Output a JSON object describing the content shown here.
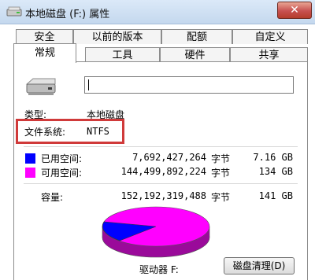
{
  "window": {
    "title": "本地磁盘 (F:) 属性",
    "close_glyph": "✕"
  },
  "tabs": {
    "row1": [
      "安全",
      "以前的版本",
      "配额",
      "自定义"
    ],
    "row2": [
      "常规",
      "工具",
      "硬件",
      "共享"
    ],
    "active": "常规"
  },
  "general": {
    "name_value": "",
    "type_label": "类型:",
    "type_value": "本地磁盘",
    "fs_label": "文件系统:",
    "fs_value": "NTFS",
    "used": {
      "label": "已用空间:",
      "bytes": "7,692,427,264",
      "unit": "字节",
      "size": "7.16 GB",
      "color": "#0000ff"
    },
    "free": {
      "label": "可用空间:",
      "bytes": "144,499,892,224",
      "unit": "字节",
      "size": "134 GB",
      "color": "#ff00ff"
    },
    "capacity": {
      "label": "容量:",
      "bytes": "152,192,319,488",
      "unit": "字节",
      "size": "141 GB"
    },
    "drive_label": "驱动器 F:",
    "cleanup_button": "磁盘清理(D)"
  },
  "icons": {
    "title": "drive-icon",
    "drive": "hard-disk-icon"
  }
}
